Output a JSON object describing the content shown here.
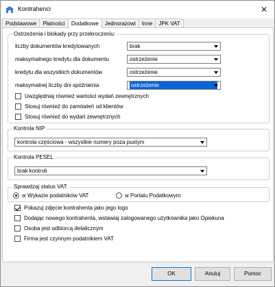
{
  "window": {
    "title": "Kontrahenci",
    "close_glyph": "✕"
  },
  "tabs": [
    "Podstawowe",
    "Płatności",
    "Dodatkowe",
    "Jednorazowi",
    "Inne",
    "JPK VAT"
  ],
  "active_tab": "Dodatkowe",
  "limits": {
    "title": "Ostrzeżenia i blokady przy przekroczeniu:",
    "rows": [
      {
        "label": "liczby dokumentów kredytowanych",
        "value": "brak"
      },
      {
        "label": "maksymalnego kredytu dla  dokumentu",
        "value": "ostrzeżenie"
      },
      {
        "label": "kredytu dla wszystkich dokumentów",
        "value": "ostrzeżenie"
      },
      {
        "label": "maksymalnej liczby dni spóźnienia",
        "value": "ostrzeżenie"
      }
    ],
    "checkboxes": [
      {
        "label": "Uwzględniaj również wartości wydań zewnętrznych",
        "checked": false
      },
      {
        "label": "Stosuj również do zamówień od klientów",
        "checked": false
      },
      {
        "label": "Stosuj również do wydań zewnętrznych",
        "checked": false
      }
    ]
  },
  "nip": {
    "title": "Kontrola NIP",
    "value": "kontrola częściowa - wszystkie numery poza pustym"
  },
  "pesel": {
    "title": "Kontrola PESEL",
    "value": "brak kontroli"
  },
  "vat": {
    "title": "Sprawdzaj status VAT:",
    "options": [
      "w Wykazie podatników VAT",
      "w Portalu Podatkowym"
    ],
    "selected_index": 0
  },
  "options": [
    {
      "label": "Pokazuj zdjęcie kontrahenta jako jego logo",
      "checked": true
    },
    {
      "label": "Dodając nowego kontrahenta, wstawiaj zalogowanego użytkownika jako Opiekuna",
      "checked": false
    },
    {
      "label": "Osoba jest odbiorcą detalicznym",
      "checked": false
    },
    {
      "label": "Firma jest czynnym podatnikiem VAT",
      "checked": false
    }
  ],
  "buttons": {
    "ok": "OK",
    "cancel": "Anuluj",
    "help": "Pomoc"
  }
}
